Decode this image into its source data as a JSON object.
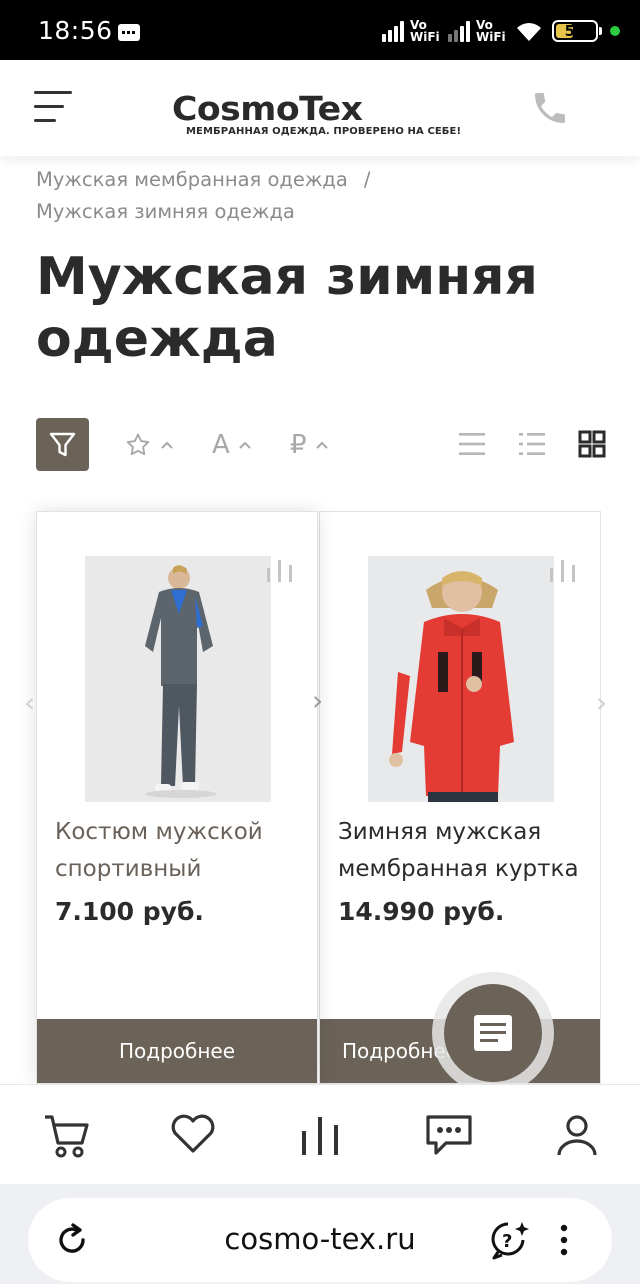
{
  "status_bar": {
    "time": "18:56",
    "vowifi_1": "Vo WiFi",
    "vowifi_2": "Vo WiFi",
    "battery": "50",
    "battery_level": 0.5
  },
  "header": {
    "logo_main": "CosmoTex",
    "logo_tagline": "МЕМБРАННАЯ ОДЕЖДА. ПРОВЕРЕНО НА СЕБЕ!",
    "menu_icon": "hamburger-icon",
    "phone_icon": "phone-icon"
  },
  "breadcrumbs": {
    "item1": "Мужская мембранная одежда",
    "separator": "/",
    "item2": "Мужская зимняя одежда"
  },
  "page": {
    "title": "Мужская зимняя одежда"
  },
  "toolbar": {
    "filter_icon": "filter-icon",
    "sort_rating_icon": "star-icon",
    "sort_name_letter": "А",
    "sort_price_symbol": "₽",
    "view_options": [
      "list-icon",
      "list-compact-icon",
      "grid-icon"
    ],
    "active_view": "grid-icon"
  },
  "products": [
    {
      "name_line1": "Костюм мужской",
      "name_line2": "спортивный",
      "price": "7.100 руб.",
      "button": "Подробнее"
    },
    {
      "name_line1": "Зимняя мужская",
      "name_line2": "мембранная куртка",
      "price": "14.990 руб.",
      "button": "Подробнее"
    }
  ],
  "bottom_nav": [
    "cart-icon",
    "heart-icon",
    "compare-icon",
    "chat-icon",
    "user-icon"
  ],
  "browser": {
    "url": "cosmo-tex.ru"
  },
  "colors": {
    "accent": "#6b6357",
    "muted_text": "#8b8b8b",
    "title": "#2b2b2b"
  }
}
